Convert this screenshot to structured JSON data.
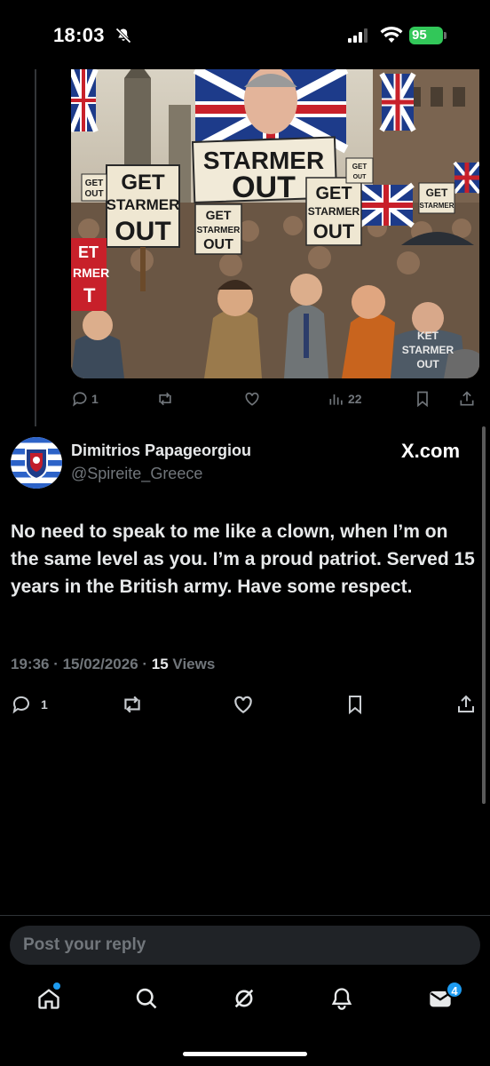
{
  "status_bar": {
    "time": "18:03",
    "battery": "95"
  },
  "parent_post": {
    "image": {
      "signs": [
        "STARMER OUT",
        "GET STARMER OUT",
        "GET STARMER OUT",
        "GET STARMER OUT",
        "GET STARMER OUT",
        "KET STARMER OUT",
        "GET OUT",
        "GET STARMER",
        "GET STARMER OUT",
        "ET RMER T"
      ]
    },
    "actions": {
      "replies": "1",
      "views": "22"
    }
  },
  "post": {
    "author_name": "Dimitrios Papageorgiou",
    "author_handle": "@Spireite_Greece",
    "watermark": "X.com",
    "text": "No need to speak to me like a clown, when I’m on the same level as you. I’m a proud patriot. Served 15 years in the British army. Have some respect.",
    "time_date": "19:36 · 15/02/2026 · ",
    "views_count": "15",
    "views_label": " Views",
    "actions": {
      "replies": "1"
    }
  },
  "reply": {
    "placeholder": "Post your reply"
  },
  "nav": {
    "messages_badge": "4"
  },
  "colors": {
    "accent": "#1d9bf0",
    "background": "#000000",
    "muted": "#71767b",
    "battery": "#32c759"
  }
}
